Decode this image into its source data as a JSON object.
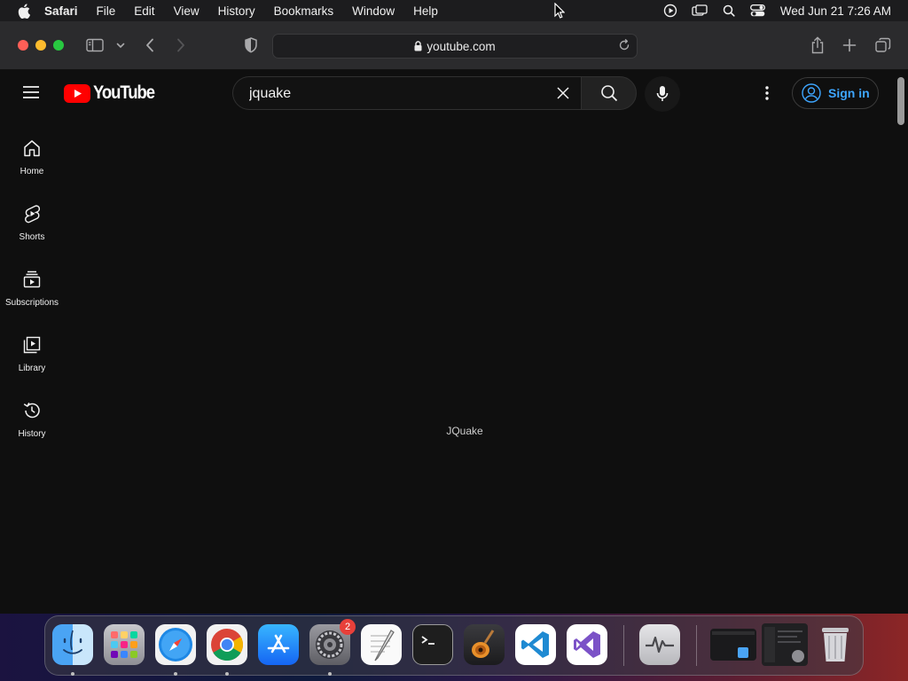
{
  "menubar": {
    "app_name": "Safari",
    "menus": [
      "File",
      "Edit",
      "View",
      "History",
      "Bookmarks",
      "Window",
      "Help"
    ],
    "clock": "Wed Jun 21  7:26 AM"
  },
  "browser": {
    "url": "youtube.com"
  },
  "youtube": {
    "logo_text": "YouTube",
    "search": {
      "value": "jquake"
    },
    "signin_label": "Sign in",
    "guide": [
      {
        "label": "Home",
        "icon": "home-icon"
      },
      {
        "label": "Shorts",
        "icon": "shorts-icon"
      },
      {
        "label": "Subscriptions",
        "icon": "subscriptions-icon"
      },
      {
        "label": "Library",
        "icon": "library-icon"
      },
      {
        "label": "History",
        "icon": "history-icon"
      }
    ],
    "result_text": "JQuake"
  },
  "dock": {
    "apps": [
      {
        "name": "Finder",
        "icon": "finder-icon"
      },
      {
        "name": "Launchpad",
        "icon": "launchpad-icon"
      },
      {
        "name": "Safari",
        "icon": "safari-icon"
      },
      {
        "name": "Google Chrome",
        "icon": "chrome-icon"
      },
      {
        "name": "App Store",
        "icon": "app-store-icon"
      },
      {
        "name": "System Settings",
        "icon": "settings-icon",
        "badge": "2"
      },
      {
        "name": "TextEdit",
        "icon": "textedit-icon"
      },
      {
        "name": "Terminal",
        "icon": "terminal-icon"
      },
      {
        "name": "GarageBand",
        "icon": "garageband-icon"
      },
      {
        "name": "Visual Studio Code",
        "icon": "vscode-icon"
      },
      {
        "name": "Visual Studio",
        "icon": "visual-studio-icon"
      },
      {
        "name": "Activity Monitor",
        "icon": "activity-monitor-icon"
      },
      {
        "name": "Window thumbnail 1",
        "icon": "window-thumbnail-icon"
      },
      {
        "name": "Window thumbnail 2",
        "icon": "window-thumbnail-icon"
      },
      {
        "name": "Trash",
        "icon": "trash-icon"
      }
    ]
  }
}
